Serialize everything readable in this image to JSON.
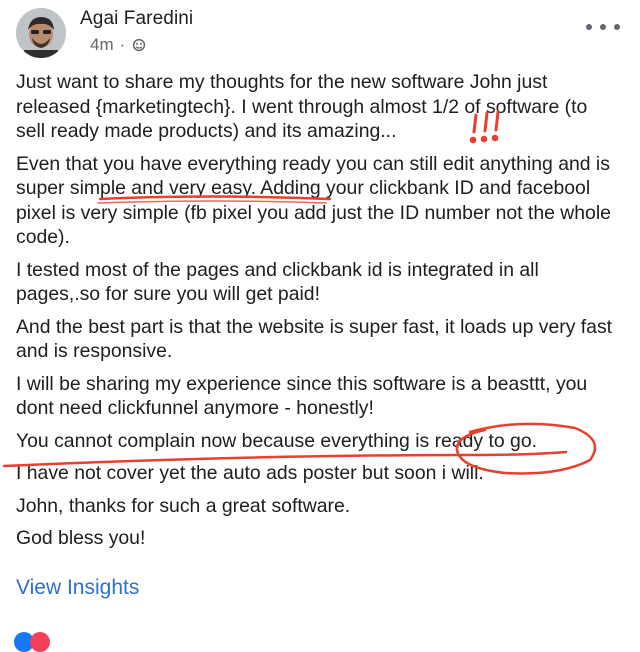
{
  "post": {
    "author": "Agai Faredini",
    "time": "4m",
    "privacy_icon": "friends-icon",
    "paragraphs": [
      "Just want to share my thoughts for the new software John just released {marketingtech}.  I went through almost 1/2 of software (to sell ready made products) and its amazing...",
      "Even that you have everything ready you can still edit anything and is super simple and very easy. Adding your clickbank ID and facebool pixel is very simple (fb pixel you add just the ID number not the whole code).",
      "I tested most of the pages and clickbank id is integrated in all pages,.so for sure you will get paid!",
      "And the best part is that the website is super fast, it loads up very fast and is responsive.",
      "I will be sharing my experience since this software is a beasttt, you dont need clickfunnel anymore - honestly!",
      "You cannot complain now because everything is ready to go.",
      "I have not cover yet the auto ads poster but soon i will.",
      "John, thanks for such a great software.",
      "God bless you!"
    ],
    "annotation": "!!!",
    "view_insights": "View Insights"
  },
  "colors": {
    "link": "#2d6fd2",
    "marker": "#e8402e",
    "meta": "#65676b"
  }
}
